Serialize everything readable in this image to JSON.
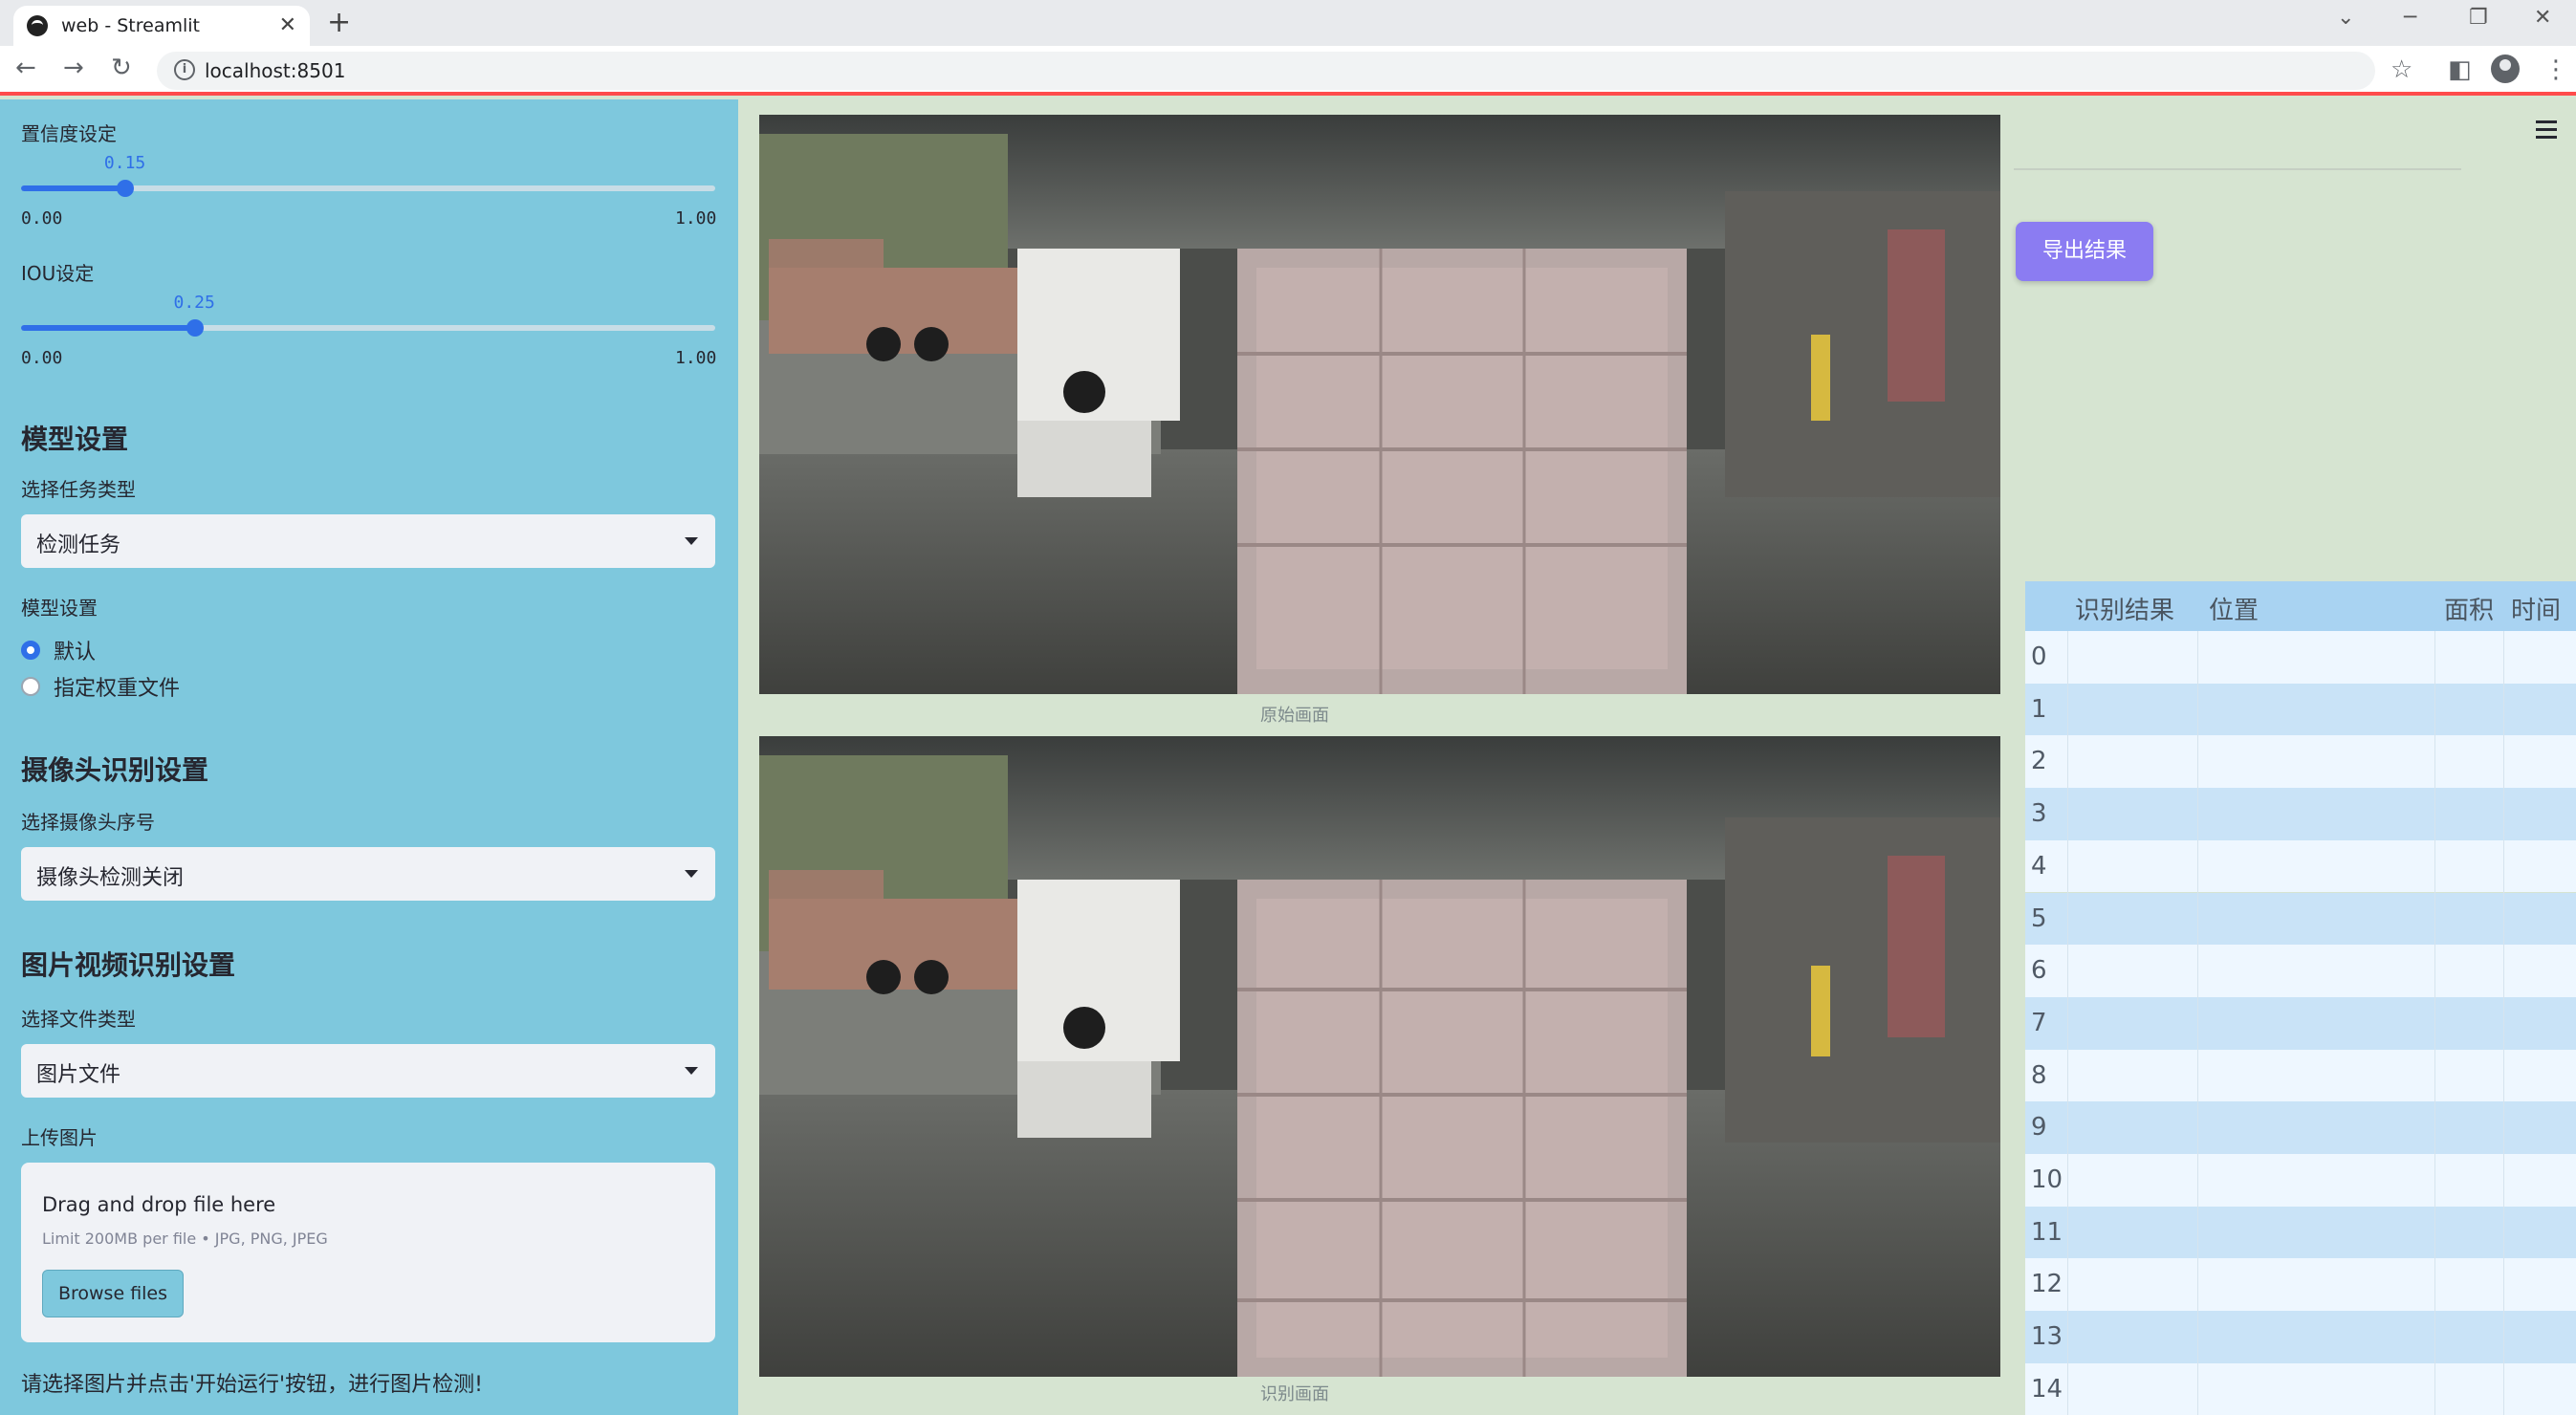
{
  "browser": {
    "tab_title": "web - Streamlit",
    "tab_close": "✕",
    "new_tab": "+",
    "url": "localhost:8501",
    "controls": {
      "dropdown": "⌄",
      "minimize": "─",
      "restore": "❐",
      "close": "✕"
    },
    "nav": {
      "back": "←",
      "forward": "→",
      "reload": "↻"
    },
    "toolbar_icons": {
      "star": "☆",
      "sidebar": "◧",
      "menu": "⋮"
    }
  },
  "sidebar": {
    "confidence": {
      "label": "置信度设定",
      "value": "0.15",
      "value_num": 0.15,
      "min": "0.00",
      "max": "1.00"
    },
    "iou": {
      "label": "IOU设定",
      "value": "0.25",
      "value_num": 0.25,
      "min": "0.00",
      "max": "1.00"
    },
    "model_section": {
      "heading": "模型设置",
      "task_label": "选择任务类型",
      "task_value": "检测任务",
      "model_label": "模型设置",
      "options": [
        "默认",
        "指定权重文件"
      ],
      "selected": 0
    },
    "camera_section": {
      "heading": "摄像头识别设置",
      "camera_label": "选择摄像头序号",
      "camera_value": "摄像头检测关闭"
    },
    "media_section": {
      "heading": "图片视频识别设置",
      "file_type_label": "选择文件类型",
      "file_type_value": "图片文件",
      "upload_label": "上传图片",
      "drop_title": "Drag and drop file here",
      "drop_limit": "Limit 200MB per file • JPG, PNG, JPEG",
      "browse_label": "Browse files"
    },
    "hint": "请选择图片并点击'开始运行'按钮，进行图片检测!"
  },
  "main": {
    "original_caption": "原始画面",
    "result_caption": "识别画面",
    "export_label": "导出结果",
    "table": {
      "columns": [
        "识别结果",
        "位置",
        "面积",
        "时间"
      ],
      "rows": [
        "0",
        "1",
        "2",
        "3",
        "4",
        "5",
        "6",
        "7",
        "8",
        "9",
        "10",
        "11",
        "12",
        "13",
        "14"
      ]
    }
  },
  "colors": {
    "sidebar_bg": "#7ec8dd",
    "main_bg": "#d6e4d1",
    "accent": "#2f6fe8",
    "export_button": "#8b7cf2",
    "table_header": "#a9d3f2"
  }
}
